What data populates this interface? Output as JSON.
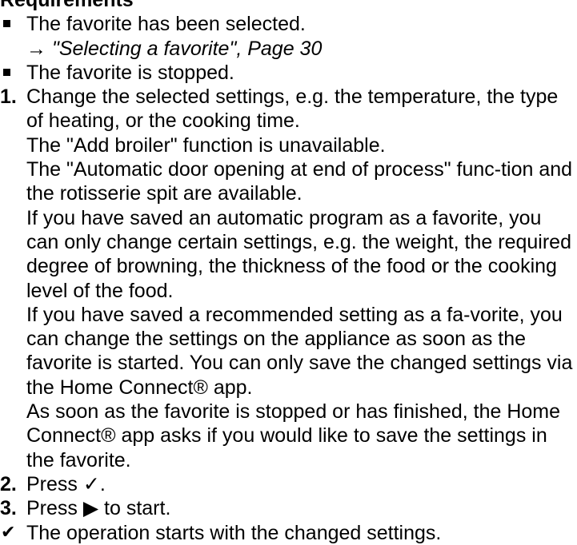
{
  "section": {
    "heading": "Requirements"
  },
  "requirements": [
    {
      "text": "The favorite has been selected.",
      "ref_arrow": "→",
      "ref_text": "\"Selecting a favorite\", Page 30"
    },
    {
      "text": "The favorite is stopped."
    }
  ],
  "steps": [
    {
      "number": "1.",
      "paragraphs": [
        "Change the selected settings, e.g. the temperature, the type of heating, or the cooking time.",
        "The \"Add broiler\" function is unavailable.",
        "The \"Automatic door opening at end of process\" func-tion and the rotisserie spit are available.",
        "If you have saved an automatic program as a favorite, you can only change certain settings, e.g. the weight, the required degree of browning, the thickness of the food or the cooking level of the food.",
        "If you have saved a recommended setting as a fa-vorite, you can change the settings on the appliance as soon as the favorite is started. You can only save the changed settings via the Home Connect® app.",
        "As soon as the favorite is stopped or has finished, the Home Connect® app asks if you would like to save the settings in the favorite."
      ]
    },
    {
      "number": "2.",
      "before": "Press ",
      "icon": "✓",
      "after": "."
    },
    {
      "number": "3.",
      "before": "Press ",
      "icon": "▶",
      "after": " to start."
    }
  ],
  "result": {
    "marker": "✔",
    "text": "The operation starts with the changed settings."
  }
}
